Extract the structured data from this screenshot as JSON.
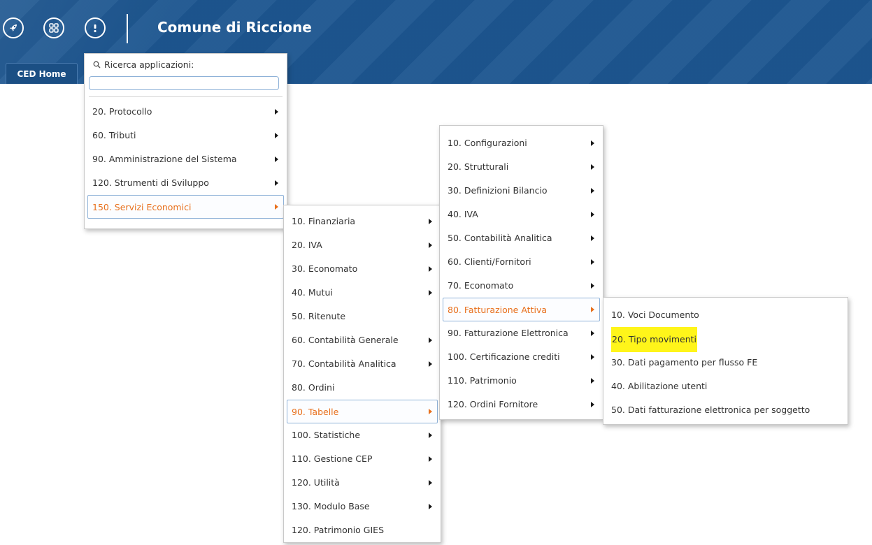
{
  "header": {
    "title": "Comune di Riccione",
    "icons": [
      "rocket-icon",
      "apps-grid-icon",
      "info-icon"
    ],
    "color": "#1d5690"
  },
  "tabs": [
    {
      "label": "CED Home"
    }
  ],
  "app_menu": {
    "search_label": "Ricerca applicazioni:",
    "search_value": "",
    "items": [
      {
        "label": "20. Protocollo",
        "submenu": true
      },
      {
        "label": "60. Tributi",
        "submenu": true
      },
      {
        "label": "90. Amministrazione del Sistema",
        "submenu": true
      },
      {
        "label": "120. Strumenti di Sviluppo",
        "submenu": true
      },
      {
        "label": "150. Servizi Economici",
        "submenu": true,
        "active": true
      }
    ]
  },
  "servizi_economici_menu": {
    "items": [
      {
        "label": "10. Finanziaria",
        "submenu": true
      },
      {
        "label": "20. IVA",
        "submenu": true
      },
      {
        "label": "30. Economato",
        "submenu": true
      },
      {
        "label": "40. Mutui",
        "submenu": true
      },
      {
        "label": "50. Ritenute",
        "submenu": false
      },
      {
        "label": "60. Contabilità Generale",
        "submenu": true
      },
      {
        "label": "70. Contabilità Analitica",
        "submenu": true
      },
      {
        "label": "80. Ordini",
        "submenu": false
      },
      {
        "label": "90. Tabelle",
        "submenu": true,
        "active": true
      },
      {
        "label": "100. Statistiche",
        "submenu": true
      },
      {
        "label": "110. Gestione CEP",
        "submenu": true
      },
      {
        "label": "120. Utilità",
        "submenu": true
      },
      {
        "label": "130. Modulo Base",
        "submenu": true
      },
      {
        "label": "120. Patrimonio GIES",
        "submenu": false
      }
    ]
  },
  "tabelle_menu": {
    "items": [
      {
        "label": "10. Configurazioni",
        "submenu": true
      },
      {
        "label": "20. Strutturali",
        "submenu": true
      },
      {
        "label": "30. Definizioni Bilancio",
        "submenu": true
      },
      {
        "label": "40. IVA",
        "submenu": true
      },
      {
        "label": "50. Contabilità Analitica",
        "submenu": true
      },
      {
        "label": "60. Clienti/Fornitori",
        "submenu": true
      },
      {
        "label": "70. Economato",
        "submenu": true
      },
      {
        "label": "80. Fatturazione Attiva",
        "submenu": true,
        "active": true
      },
      {
        "label": "90. Fatturazione Elettronica",
        "submenu": true
      },
      {
        "label": "100. Certificazione crediti",
        "submenu": true
      },
      {
        "label": "110. Patrimonio",
        "submenu": true
      },
      {
        "label": "120. Ordini Fornitore",
        "submenu": true
      }
    ]
  },
  "fatturazione_attiva_menu": {
    "items": [
      {
        "label": "10. Voci Documento"
      },
      {
        "label": "20. Tipo movimenti",
        "highlighted": true
      },
      {
        "label": "30. Dati pagamento per flusso FE"
      },
      {
        "label": "40. Abilitazione utenti"
      },
      {
        "label": "50. Dati fatturazione elettronica per soggetto"
      }
    ]
  },
  "colors": {
    "active_text": "#e8701d",
    "highlight": "#fff51a",
    "header_blue": "#1d5690"
  }
}
